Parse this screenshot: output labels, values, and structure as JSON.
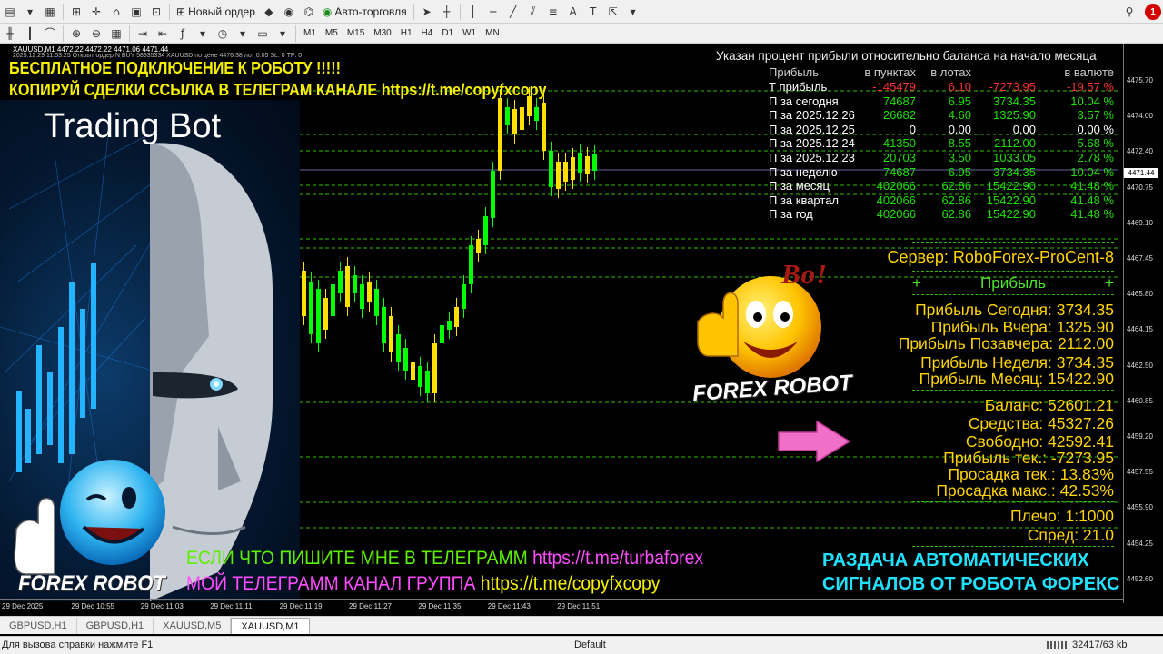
{
  "toolbar": {
    "new_order_label": "Новый ордер",
    "autotrading_label": "Авто-торговля",
    "timeframes": [
      "M1",
      "M5",
      "M15",
      "M30",
      "H1",
      "H4",
      "D1",
      "W1",
      "MN"
    ],
    "notification_count": "1"
  },
  "chart": {
    "title": "XAUUSD,M1  4472.22 4472.22 4471.06 4471.44",
    "subtitle": "2025.12.29 11:53:25  Открыт ордер N BUY 58935334 XAUUSD по цене 4476.38 лот 0.05 SL: 0 ТР: 0",
    "current_price": "4471.44",
    "price_ticks": [
      "4475.70",
      "4474.00",
      "4472.40",
      "4470.75",
      "4469.10",
      "4467.45",
      "4465.80",
      "4464.15",
      "4462.50",
      "4460.85",
      "4459.20",
      "4457.55",
      "4455.90",
      "4454.25",
      "4452.60"
    ],
    "time_ticks": [
      "29 Dec 2025",
      "29 Dec 10:55",
      "29 Dec 11:03",
      "29 Dec 11:11",
      "29 Dec 11:19",
      "29 Dec 11:27",
      "29 Dec 11:35",
      "29 Dec 11:43",
      "29 Dec 11:51"
    ]
  },
  "overlay": {
    "line1": "БЕСПЛАТНОЕ ПОДКЛЮЧЕНИЕ К РОБОТУ !!!!!",
    "line2": "КОПИРУЙ СДЕЛКИ ССЫЛКА В ТЕЛЕГРАМ КАНАЛЕ https://t.me/copyfxcopy",
    "bot_title": "Trading Bot",
    "vo": "Bo!",
    "forex_robot_1": "FOREX ROBOT",
    "forex_robot_2": "FOREX ROBOT",
    "tg_text1": "ЕСЛИ ЧТО ПИШИТЕ МНЕ В ТЕЛЕГРАММ",
    "tg_link1": "https://t.me/turbaforex",
    "tg_text2": "МОЙ ТЕЛЕГРАММ КАНАЛ ГРУППА",
    "tg_link2": "https://t.me/copyfxcopy",
    "signals_line1": "РАЗДАЧА АВТОМАТИЧЕСКИХ",
    "signals_line2": "СИГНАЛОВ ОТ РОБОТА ФОРЕКС"
  },
  "profit_table": {
    "header": "Указан процент прибыли относительно баланса на начало месяца",
    "columns": [
      "Прибыль",
      "в пунктах",
      "в лотах",
      "",
      "в валюте"
    ],
    "rows": [
      {
        "label": "Т прибыль",
        "points": "-145479",
        "lots": "6.10",
        "money": "-7273.95",
        "pct": "-19.57 %",
        "sign": "neg"
      },
      {
        "label": "П за сегодня",
        "points": "74687",
        "lots": "6.95",
        "money": "3734.35",
        "pct": "10.04 %",
        "sign": "pos"
      },
      {
        "label": "П за 2025.12.26",
        "points": "26682",
        "lots": "4.60",
        "money": "1325.90",
        "pct": "3.57 %",
        "sign": "pos"
      },
      {
        "label": "П за 2025.12.25",
        "points": "0",
        "lots": "0.00",
        "money": "0.00",
        "pct": "0.00 %",
        "sign": "zero"
      },
      {
        "label": "П за 2025.12.24",
        "points": "41350",
        "lots": "8.55",
        "money": "2112.00",
        "pct": "5.68 %",
        "sign": "pos"
      },
      {
        "label": "П за 2025.12.23",
        "points": "20703",
        "lots": "3.50",
        "money": "1033.05",
        "pct": "2.78 %",
        "sign": "pos"
      },
      {
        "label": "П за неделю",
        "points": "74687",
        "lots": "6.95",
        "money": "3734.35",
        "pct": "10.04 %",
        "sign": "pos"
      },
      {
        "label": "П за месяц",
        "points": "402066",
        "lots": "62.86",
        "money": "15422.90",
        "pct": "41.48 %",
        "sign": "pos"
      },
      {
        "label": "П за квартал",
        "points": "402066",
        "lots": "62.86",
        "money": "15422.90",
        "pct": "41.48 %",
        "sign": "pos"
      },
      {
        "label": "П за год",
        "points": "402066",
        "lots": "62.86",
        "money": "15422.90",
        "pct": "41.48 %",
        "sign": "pos"
      }
    ]
  },
  "panel": {
    "server": "Сервер: RoboForex-ProCent-8",
    "profit_title": "Прибыль",
    "profit_plus": "+",
    "profit_today": "Прибыль Сегодня: 3734.35",
    "profit_yesterday": "Прибыль Вчера: 1325.90",
    "profit_before_yesterday": "Прибыль Позавчера: 2112.00",
    "profit_week": "Прибыль Неделя: 3734.35",
    "profit_month": "Прибыль Месяц: 15422.90",
    "balance": "Баланс: 52601.21",
    "equity": "Средства: 45327.26",
    "free": "Свободно: 42592.41",
    "profit_current": "Прибыль тек.:  -7273.95",
    "drawdown_current": "Просадка тек.:  13.83%",
    "drawdown_max": "Просадка макс.:  42.53%",
    "leverage": "Плечо: 1:1000",
    "spread": "Спред: 21.0"
  },
  "tabs": [
    "GBPUSD,H1",
    "GBPUSD,H1",
    "XAUUSD,M5",
    "XAUUSD,M1"
  ],
  "active_tab": "XAUUSD,M1",
  "status": {
    "help": "Для вызова справки нажмите F1",
    "profile": "Default",
    "traffic": "32417/63 kb"
  },
  "colors": {
    "bull": "#00ff00",
    "bear": "#ffe000",
    "grid_line": "#2fbf00",
    "panel_text": "#ffd400"
  }
}
